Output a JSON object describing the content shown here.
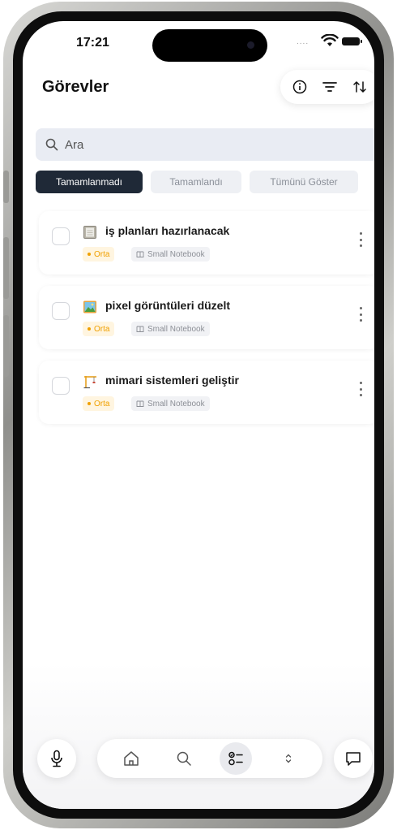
{
  "status_bar": {
    "time": "17:21",
    "signal_dots": "...."
  },
  "header": {
    "title": "Görevler"
  },
  "search": {
    "placeholder": "Ara"
  },
  "filters": [
    {
      "label": "Tamamlanmadı",
      "active": true
    },
    {
      "label": "Tamamlandı",
      "active": false
    },
    {
      "label": "Tümünü Göster",
      "active": false
    }
  ],
  "tasks": [
    {
      "title": "iş planları hazırlanacak",
      "icon": "notebook-icon",
      "priority": "Orta",
      "notebook": "Small Notebook",
      "done": false
    },
    {
      "title": "pixel görüntüleri düzelt",
      "icon": "picture-icon",
      "priority": "Orta",
      "notebook": "Small Notebook",
      "done": false
    },
    {
      "title": "mimari sistemleri geliştir",
      "icon": "crane-icon",
      "priority": "Orta",
      "notebook": "Small Notebook",
      "done": false
    }
  ],
  "bottom_nav": {
    "items": [
      "home-icon",
      "search-icon",
      "task-list-icon",
      "chevron-updown-icon"
    ],
    "active": "task-list-icon"
  },
  "colors": {
    "priority": "#f0a000",
    "active_chip": "#1f2937",
    "search_bg": "#e9ecf3"
  }
}
